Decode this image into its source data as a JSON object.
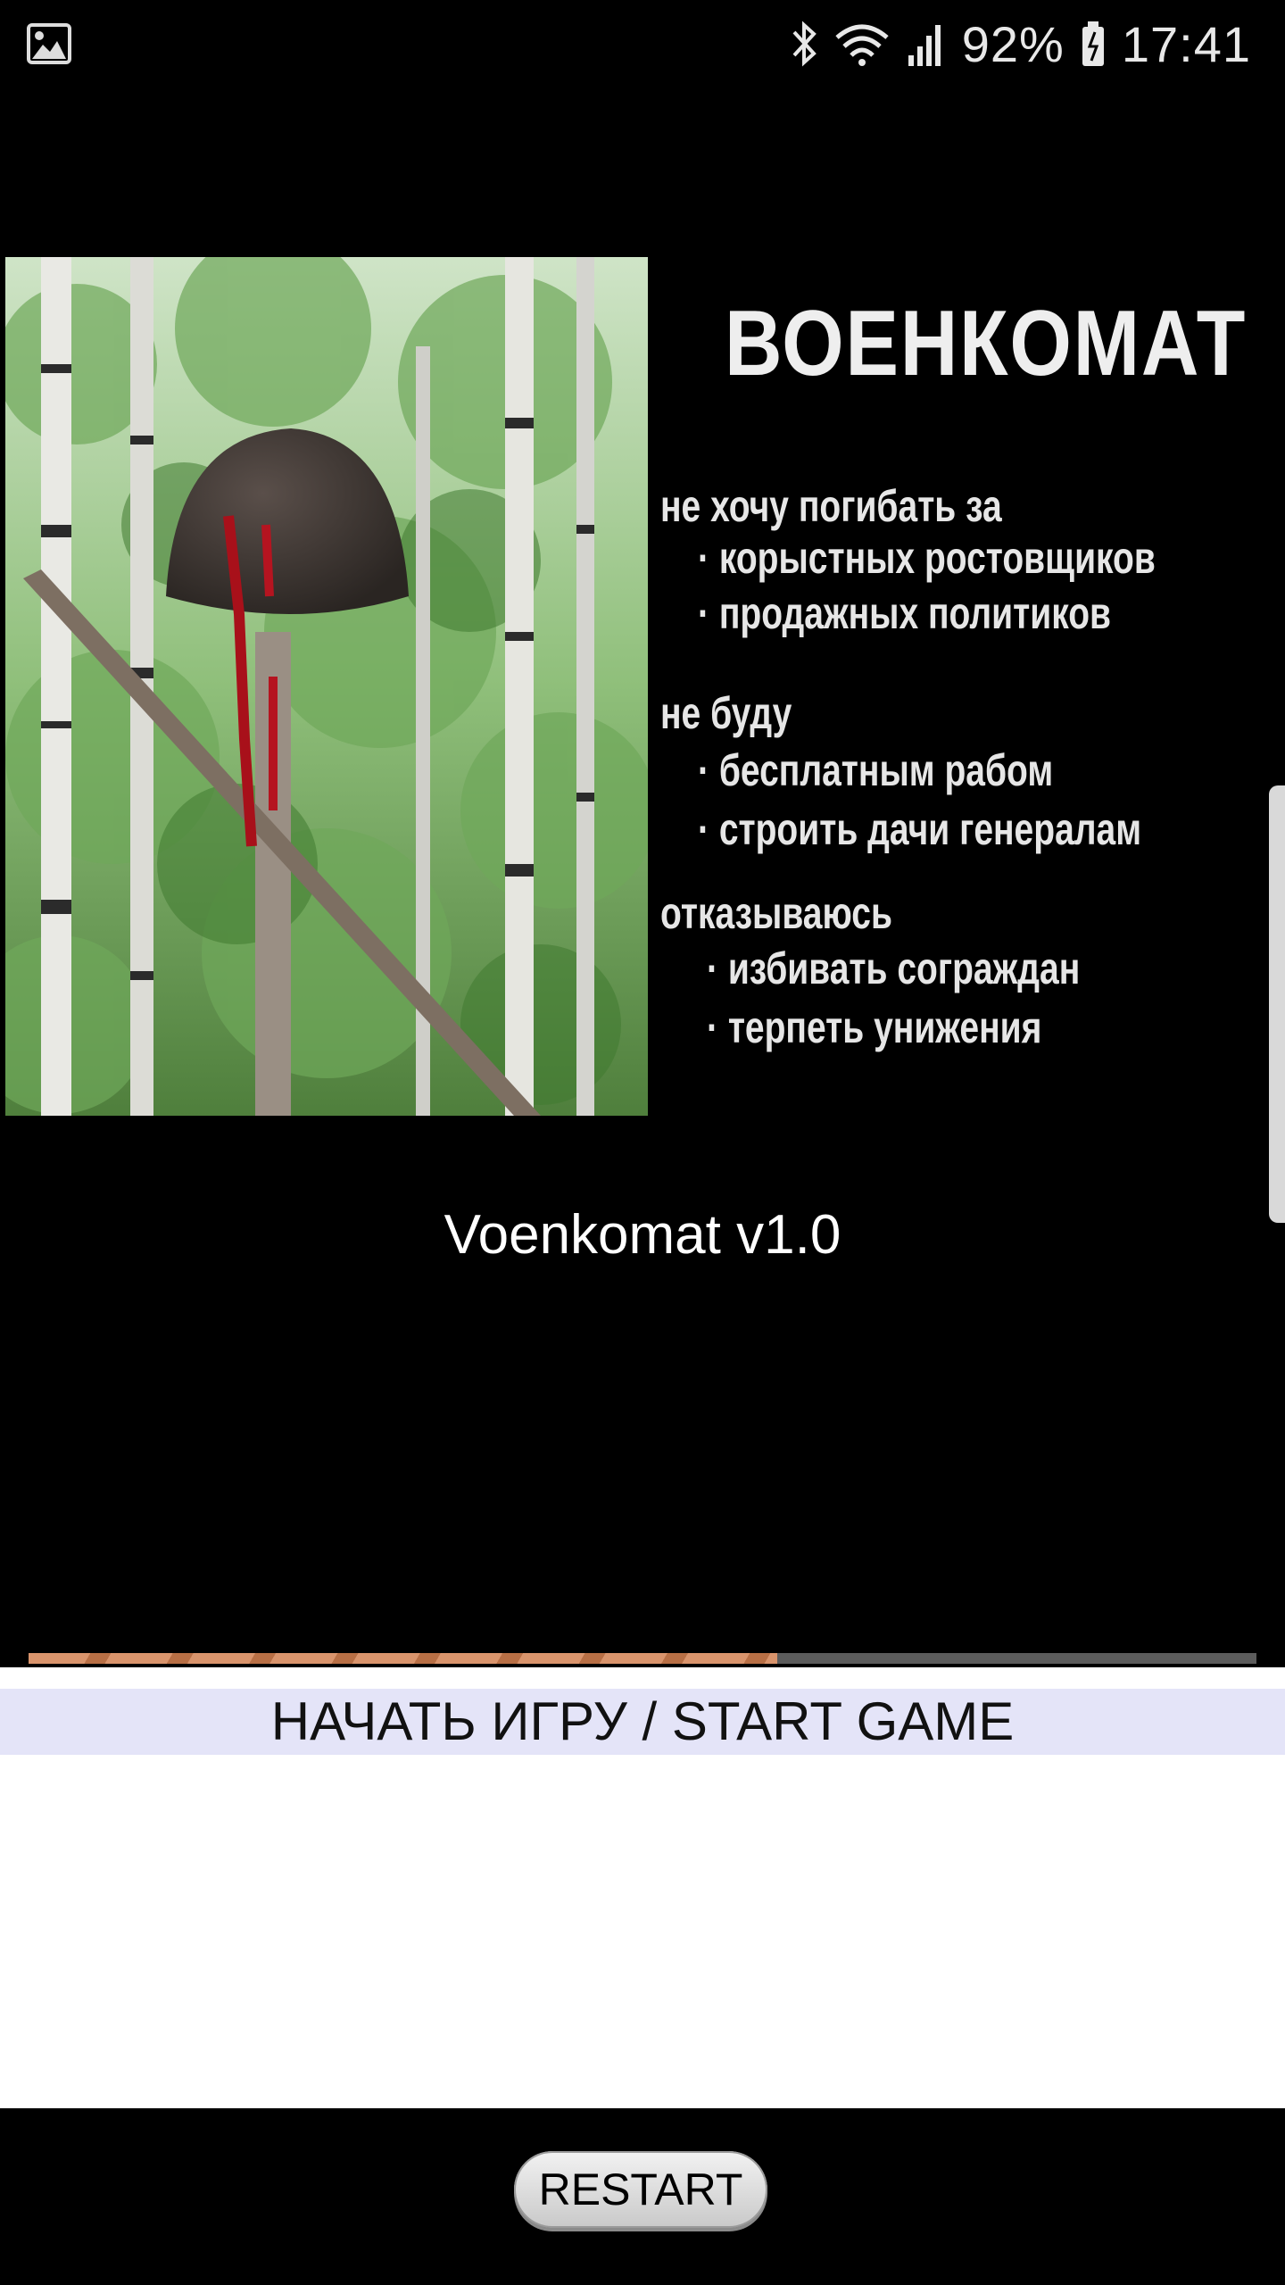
{
  "status_bar": {
    "battery": "92%",
    "time": "17:41"
  },
  "poster": {
    "title": "ВОЕНКОМАТ",
    "lines": [
      "не хочу погибать за",
      "· корыстных ростовщиков",
      "· продажных политиков",
      "не буду",
      "· бесплатным рабом",
      "· строить дачи генералам",
      "отказываюсь",
      "· избивать сограждан",
      "· терпеть унижения"
    ]
  },
  "app": {
    "title": "Voenkomat v1.0",
    "progress_fraction": 0.61,
    "start_button": "НАЧАТЬ ИГРУ / START GAME",
    "restart_button": "RESTART"
  },
  "colors": {
    "progress_fill": "#d9946c",
    "progress_track": "#5c5c5c",
    "start_button_bg": "#e4e4f8"
  }
}
